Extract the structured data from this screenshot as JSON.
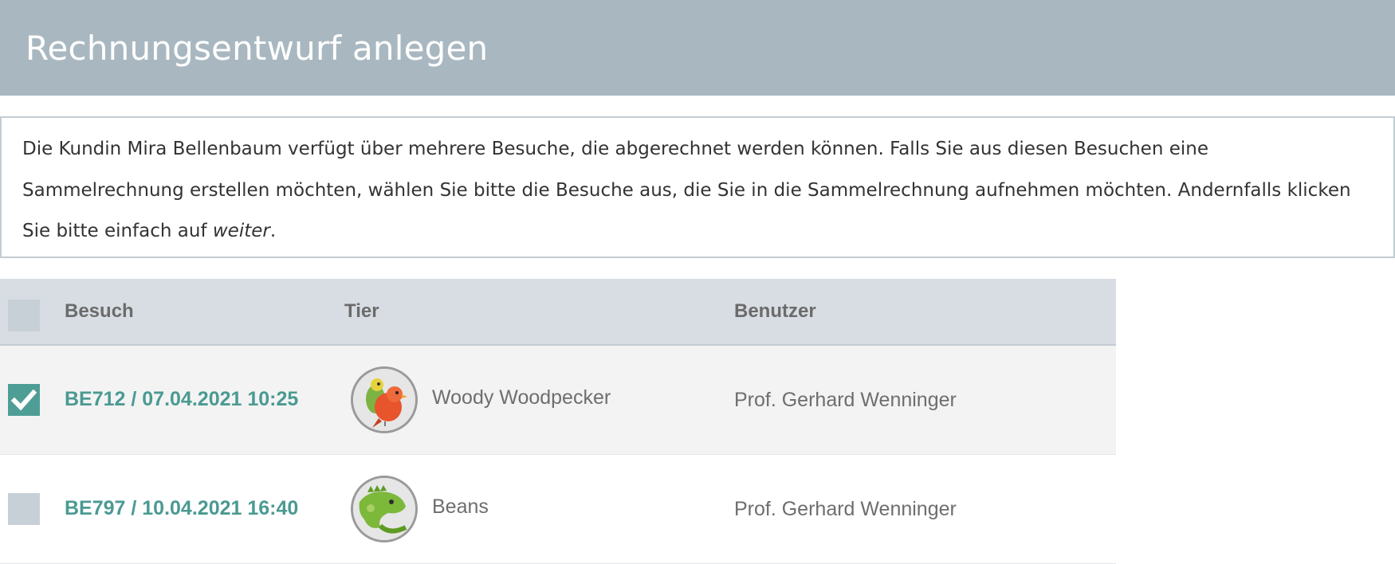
{
  "header": {
    "title": "Rechnungsentwurf anlegen"
  },
  "info": {
    "text_main": "Die Kundin Mira Bellenbaum verfügt über mehrere Besuche, die abgerechnet werden können. Falls Sie aus diesen Besuchen eine Sammelrechnung erstellen möchten, wählen Sie bitte die Besuche aus, die Sie in die Sammelrechnung aufnehmen möchten. Andernfalls klicken Sie bitte einfach auf ",
    "text_link": "weiter",
    "text_end": "."
  },
  "table": {
    "columns": {
      "visit": "Besuch",
      "animal": "Tier",
      "user": "Benutzer"
    },
    "rows": [
      {
        "visit": "BE712 / 07.04.2021 10:25",
        "animal": "Woody Woodpecker",
        "user": "Prof. Gerhard Wenninger",
        "checked": true,
        "avatar_icon": "bird-avatar-icon"
      },
      {
        "visit": "BE797 / 10.04.2021 16:40",
        "animal": "Beans",
        "user": "Prof. Gerhard Wenninger",
        "checked": false,
        "avatar_icon": "iguana-avatar-icon"
      }
    ]
  },
  "colors": {
    "header_bg": "#a9b8c0",
    "accent": "#4f9e96",
    "table_header_bg": "#d8dde3",
    "selected_row_bg": "#f3f3f3"
  }
}
